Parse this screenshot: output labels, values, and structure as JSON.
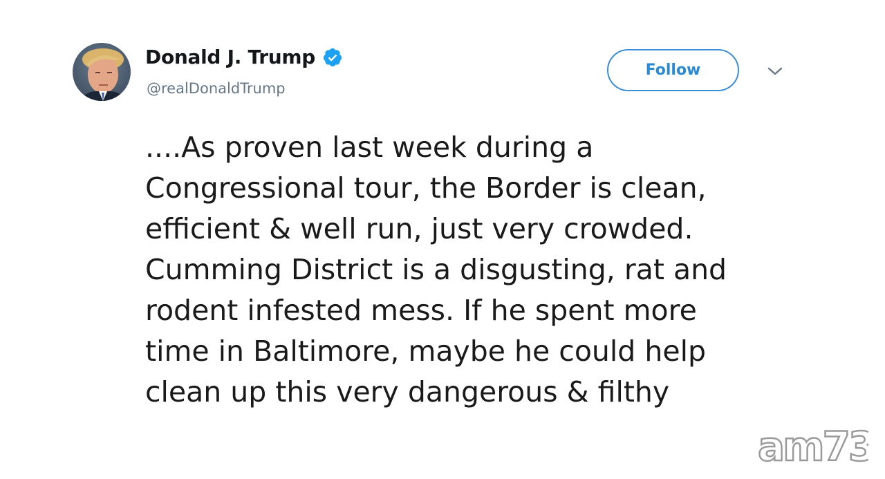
{
  "user": {
    "display_name": "Donald J. Trump",
    "handle": "@realDonaldTrump",
    "verified": true
  },
  "actions": {
    "follow_label": "Follow",
    "more_icon": "chevron-down-icon"
  },
  "tweet": {
    "lines": [
      "....As proven last week during a",
      "Congressional tour, the Border is clean,",
      "efficient & well run, just very crowded.",
      "Cumming District is a disgusting, rat and",
      "rodent infested mess. If he spent more",
      "time in Baltimore, maybe he could help",
      "clean up this very dangerous & filthy"
    ]
  },
  "watermark": {
    "text": "am730"
  },
  "colors": {
    "accent": "#1da1f2",
    "follow_border": "#3a8dd6",
    "handle": "#657786",
    "text": "#14171a",
    "watermark": "#9a9a9a"
  }
}
